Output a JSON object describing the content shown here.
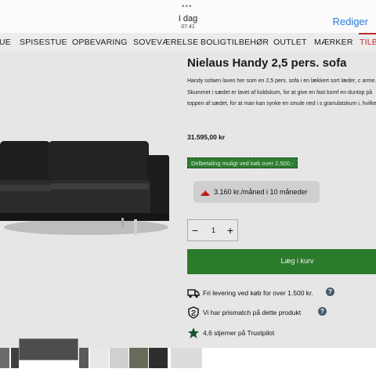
{
  "statusbar": {
    "dots": "•••",
    "day": "I dag",
    "time": "07.41",
    "edit_label": "Rediger"
  },
  "nav": {
    "items": [
      "UE",
      "SPISESTUE",
      "OPBEVARING",
      "SOVEVÆRELSE",
      "BOLIGTILBEHØR",
      "OUTLET",
      "MÆRKER",
      "TILB"
    ]
  },
  "product": {
    "title": "Nielaus Handy 2,5 pers. sofa",
    "description": "Handy sofaen laves her som en 2,5 pers. sofa i en lækkert sort læder, c arme. Skummet i sædet er lavet af koldskum, for at give en fast komf en duntop på toppen af sædet, for at man kan synke en smule ned i s granulatskum i, hvilket...",
    "price": "31.595,00 kr",
    "partial_payment": "Delbetaling muligt ved køb over 2.500,-",
    "installment": "3.160 kr./måned i 10 måneder",
    "quantity": "1",
    "minus": "−",
    "plus": "+",
    "cart_label": "Læg i kurv"
  },
  "features": [
    {
      "icon": "truck-icon",
      "text": "Fri levering ved køb for over 1.500 kr.",
      "help": "?"
    },
    {
      "icon": "shield-icon",
      "text": "Vi har prismatch på dette produkt",
      "help": "?"
    },
    {
      "icon": "star-icon",
      "text": "4,6 stjerner på Trustpilot"
    }
  ],
  "colors": {
    "accent_red": "#c1272d",
    "cart_green": "#2c7a2c",
    "edit_blue": "#2b7be0"
  }
}
